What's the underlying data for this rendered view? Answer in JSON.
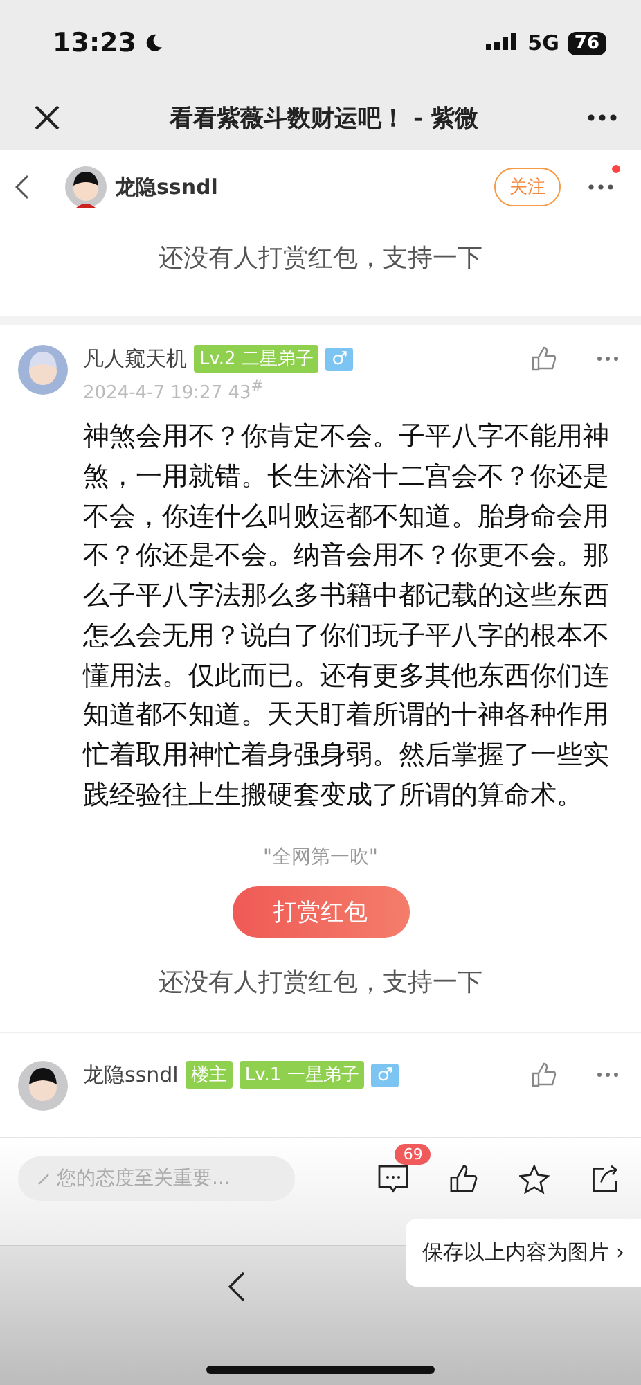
{
  "status_bar": {
    "time": "13:23",
    "network": "5G",
    "battery": "76"
  },
  "browser_bar": {
    "title": "看看紫薇斗数财运吧！ - 紫微"
  },
  "thread_header": {
    "author": "龙隐ssndl",
    "follow_label": "关注",
    "has_notification": true
  },
  "top_reward_text": "还没有人打赏红包，支持一下",
  "posts": [
    {
      "author": "凡人窥天机",
      "badges": [
        {
          "kind": "level",
          "label": "Lv.2 二星弟子"
        },
        {
          "kind": "gender",
          "label": "♂"
        }
      ],
      "time": "2024-4-7 19:27",
      "floor": "43",
      "floor_mark": "#",
      "body": "神煞会用不？你肯定不会。子平八字不能用神煞，一用就错。长生沐浴十二宫会不？你还是不会，你连什么叫败运都不知道。胎身命会用不？你还是不会。纳音会用不？你更不会。那么子平八字法那么多书籍中都记载的这些东西怎么会无用？说白了你们玩子平八字的根本不懂用法。仅此而已。还有更多其他东西你们连知道都不知道。天天盯着所谓的十神各种作用忙着取用神忙着身强身弱。然后掌握了一些实践经验往上生搬硬套变成了所谓的算命术。",
      "quote": "\"全网第一吹\"",
      "reward_button": "打赏红包",
      "reward_text": "还没有人打赏红包，支持一下"
    },
    {
      "author": "龙隐ssndl",
      "badges": [
        {
          "kind": "owner",
          "label": "楼主"
        },
        {
          "kind": "level",
          "label": "Lv.1 一星弟子"
        },
        {
          "kind": "gender",
          "label": "♂"
        }
      ]
    }
  ],
  "comment_bar": {
    "placeholder": "您的态度至关重要...",
    "comment_count": "69"
  },
  "toast": {
    "label": "保存以上内容为图片",
    "chevron": "›"
  }
}
